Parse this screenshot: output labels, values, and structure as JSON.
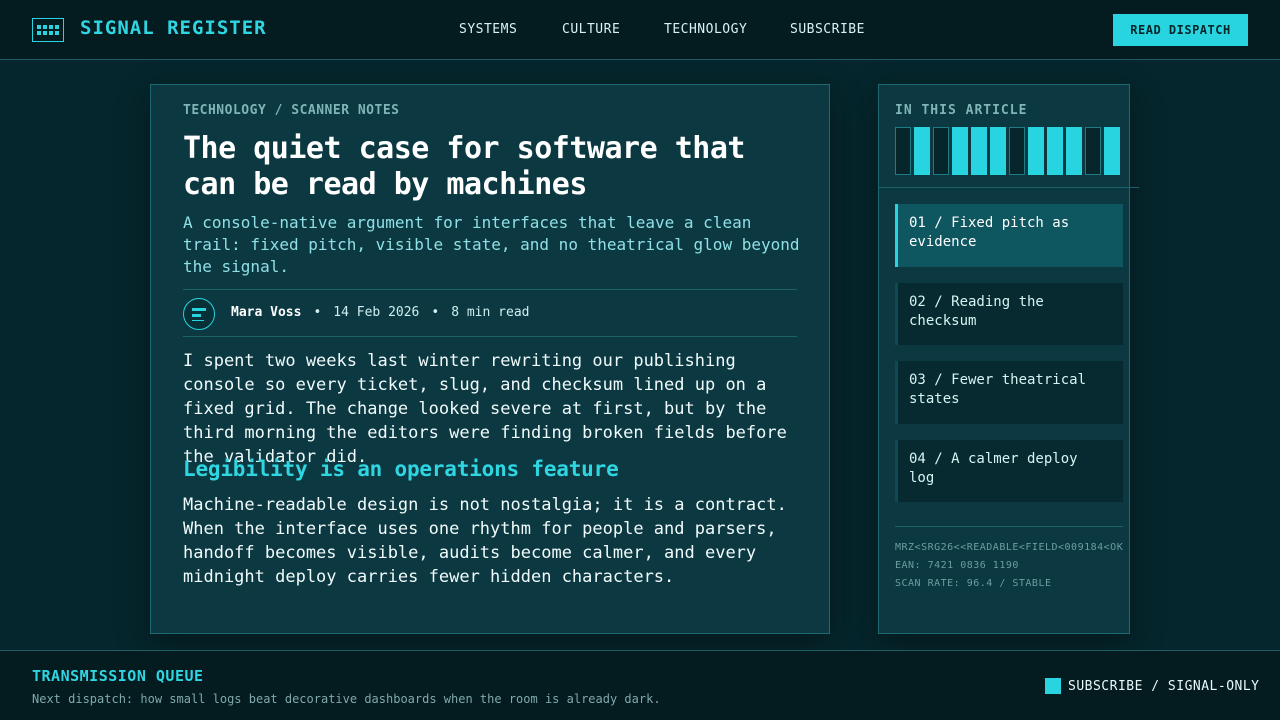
{
  "header": {
    "brand": "SIGNAL REGISTER",
    "nav": [
      "SYSTEMS",
      "CULTURE",
      "TECHNOLOGY",
      "SUBSCRIBE"
    ],
    "cta_label": "READ DISPATCH"
  },
  "article": {
    "breadcrumb": "TECHNOLOGY / SCANNER NOTES",
    "title": "The quiet case for software that can be read by machines",
    "deck": "A console-native argument for interfaces that leave a clean trail: fixed pitch, visible state, and no theatrical glow beyond the signal.",
    "meta": {
      "author": "Mara Voss",
      "separator": "•",
      "date": "14 Feb 2026",
      "read_time": "8 min read"
    },
    "paragraph_1": "I spent two weeks last winter rewriting our publishing console so every ticket, slug, and checksum lined up on a fixed grid. The change looked severe at first, but by the third morning the editors were finding broken fields before the validator did.",
    "subheading": "Legibility is an operations feature",
    "paragraph_2": "Machine-readable design is not nostalgia; it is a contract. When the interface uses one rhythm for people and parsers, handoff becomes visible, audits become calmer, and every midnight deploy carries fewer hidden characters."
  },
  "sidebar": {
    "heading": "IN THIS ARTICLE",
    "barcode_pattern": [
      0,
      1,
      0,
      1,
      1,
      1,
      0,
      1,
      1,
      1,
      0,
      1
    ],
    "toc": [
      {
        "label": "01 / Fixed pitch as evidence",
        "active": true
      },
      {
        "label": "02 / Reading the checksum",
        "active": false
      },
      {
        "label": "03 / Fewer theatrical states",
        "active": false
      },
      {
        "label": "04 / A calmer deploy log",
        "active": false
      }
    ],
    "mrz": "MRZ<SRG26<<READABLE<FIELD<009184<OK",
    "ean": "EAN: 7421 0836 1190",
    "scan_rate": "SCAN RATE: 96.4 / STABLE"
  },
  "footer": {
    "title": "TRANSMISSION QUEUE",
    "text": "Next dispatch: how small logs beat decorative dashboards when the room is already dark.",
    "subscribe_label": "SUBSCRIBE / SIGNAL-ONLY"
  },
  "colors": {
    "accent": "#27d4df",
    "background": "#05262c",
    "panel": "#0b3841",
    "header": "#041b1f"
  }
}
